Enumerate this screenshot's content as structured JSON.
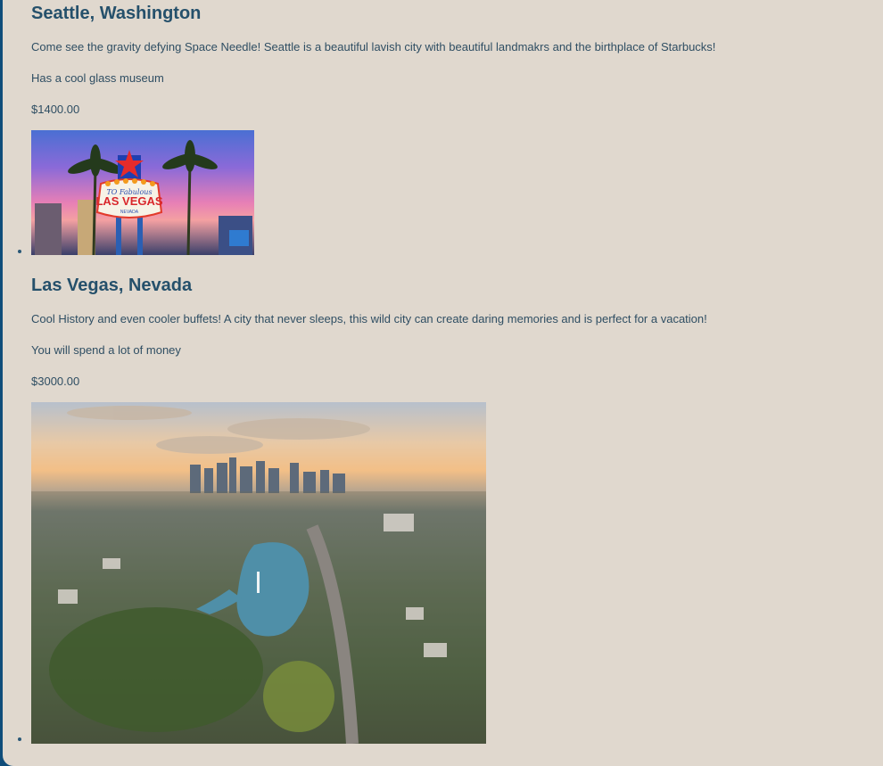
{
  "destinations": [
    {
      "title": "Seattle, Washington",
      "description": "Come see the gravity defying Space Needle! Seattle is a beautiful lavish city with beautiful landmakrs and the birthplace of Starbucks!",
      "note": "Has a cool glass museum",
      "price": "$1400.00",
      "image_subject": "las-vegas-welcome-sign"
    },
    {
      "title": "Las Vegas, Nevada",
      "description": "Cool History and even cooler buffets! A city that never sleeps, this wild city can create daring memories and is perfect for a vacation!",
      "note": "You will spend a lot of money",
      "price": "$3000.00",
      "image_subject": "los-angeles-aerial-city-view"
    }
  ],
  "images": {
    "vegas_sign": {
      "line1": "TO Fabulous",
      "line2": "LAS VEGAS",
      "line3": "NEVADA"
    }
  }
}
